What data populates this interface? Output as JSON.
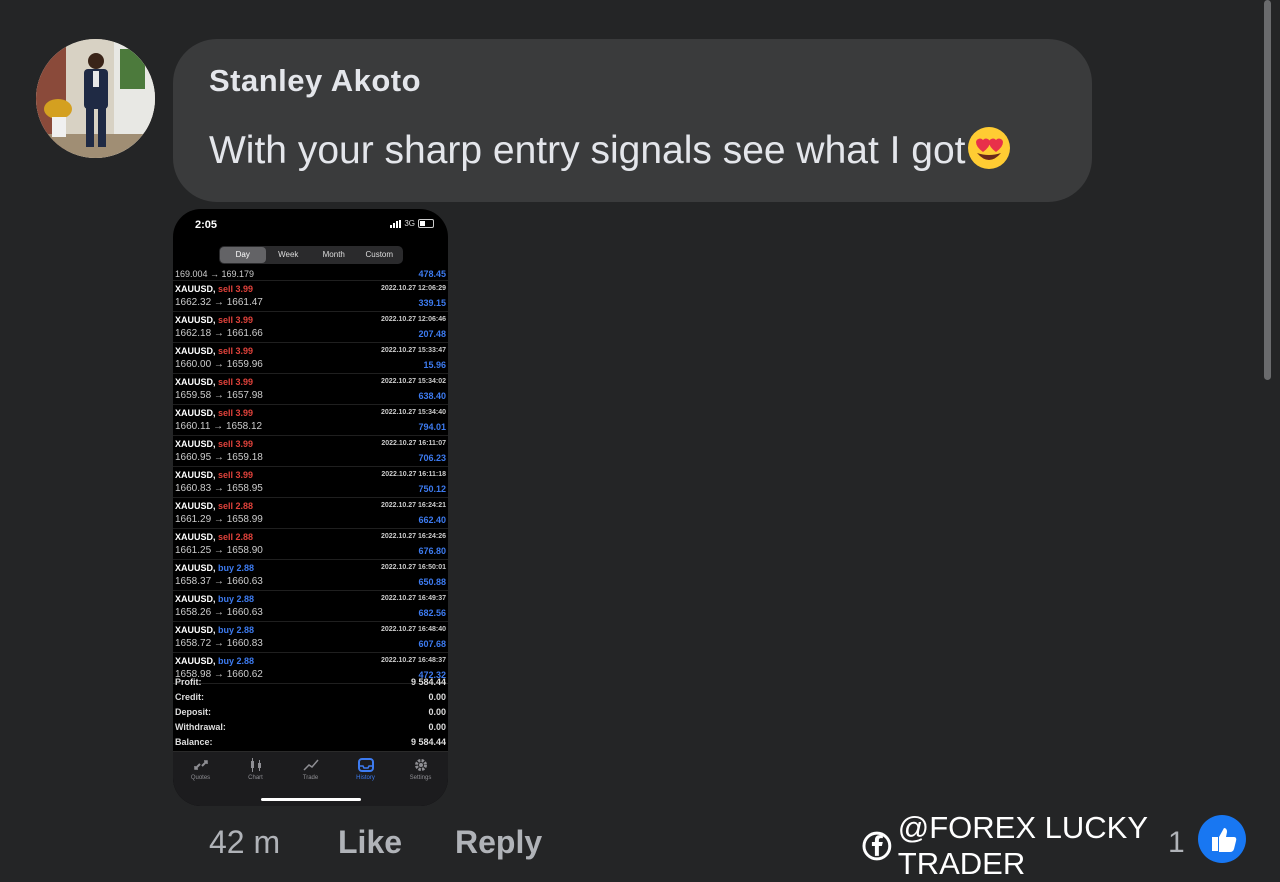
{
  "comment": {
    "author": "Stanley Akoto",
    "text": "With your sharp entry signals see what I got",
    "emoji": "heart-eyes-emoji",
    "timestamp": "42 m",
    "like_label": "Like",
    "reply_label": "Reply",
    "reaction_count": "1"
  },
  "watermark": "@FOREX LUCKY TRADER",
  "phone": {
    "status_time": "2:05",
    "network": "3G",
    "periods": [
      "Day",
      "Week",
      "Month",
      "Custom"
    ],
    "active_period": "Day",
    "partial_row": {
      "prices": "169.004 → 169.179",
      "profit": "478.45"
    },
    "deals": [
      {
        "symbol": "XAUUSD,",
        "side": "sell",
        "volume": "sell 3.99",
        "prices": "1662.32 → 1661.47",
        "time": "2022.10.27 12:06:29",
        "profit": "339.15"
      },
      {
        "symbol": "XAUUSD,",
        "side": "sell",
        "volume": "sell 3.99",
        "prices": "1662.18 → 1661.66",
        "time": "2022.10.27 12:06:46",
        "profit": "207.48"
      },
      {
        "symbol": "XAUUSD,",
        "side": "sell",
        "volume": "sell 3.99",
        "prices": "1660.00 → 1659.96",
        "time": "2022.10.27 15:33:47",
        "profit": "15.96"
      },
      {
        "symbol": "XAUUSD,",
        "side": "sell",
        "volume": "sell 3.99",
        "prices": "1659.58 → 1657.98",
        "time": "2022.10.27 15:34:02",
        "profit": "638.40"
      },
      {
        "symbol": "XAUUSD,",
        "side": "sell",
        "volume": "sell 3.99",
        "prices": "1660.11 → 1658.12",
        "time": "2022.10.27 15:34:40",
        "profit": "794.01"
      },
      {
        "symbol": "XAUUSD,",
        "side": "sell",
        "volume": "sell 3.99",
        "prices": "1660.95 → 1659.18",
        "time": "2022.10.27 16:11:07",
        "profit": "706.23"
      },
      {
        "symbol": "XAUUSD,",
        "side": "sell",
        "volume": "sell 3.99",
        "prices": "1660.83 → 1658.95",
        "time": "2022.10.27 16:11:18",
        "profit": "750.12"
      },
      {
        "symbol": "XAUUSD,",
        "side": "sell",
        "volume": "sell 2.88",
        "prices": "1661.29 → 1658.99",
        "time": "2022.10.27 16:24:21",
        "profit": "662.40"
      },
      {
        "symbol": "XAUUSD,",
        "side": "sell",
        "volume": "sell 2.88",
        "prices": "1661.25 → 1658.90",
        "time": "2022.10.27 16:24:26",
        "profit": "676.80"
      },
      {
        "symbol": "XAUUSD,",
        "side": "buy",
        "volume": "buy 2.88",
        "prices": "1658.37 → 1660.63",
        "time": "2022.10.27 16:50:01",
        "profit": "650.88"
      },
      {
        "symbol": "XAUUSD,",
        "side": "buy",
        "volume": "buy 2.88",
        "prices": "1658.26 → 1660.63",
        "time": "2022.10.27 16:49:37",
        "profit": "682.56"
      },
      {
        "symbol": "XAUUSD,",
        "side": "buy",
        "volume": "buy 2.88",
        "prices": "1658.72 → 1660.83",
        "time": "2022.10.27 16:48:40",
        "profit": "607.68"
      },
      {
        "symbol": "XAUUSD,",
        "side": "buy",
        "volume": "buy 2.88",
        "prices": "1658.98 → 1660.62",
        "time": "2022.10.27 16:48:37",
        "profit": "472.32"
      }
    ],
    "summary": [
      {
        "label": "Profit:",
        "value": "9 584.44"
      },
      {
        "label": "Credit:",
        "value": "0.00"
      },
      {
        "label": "Deposit:",
        "value": "0.00"
      },
      {
        "label": "Withdrawal:",
        "value": "0.00"
      },
      {
        "label": "Balance:",
        "value": "9 584.44"
      }
    ],
    "tabs": [
      {
        "label": "Quotes",
        "icon": "quotes-icon"
      },
      {
        "label": "Chart",
        "icon": "chart-icon"
      },
      {
        "label": "Trade",
        "icon": "trade-icon"
      },
      {
        "label": "History",
        "icon": "history-icon"
      },
      {
        "label": "Settings",
        "icon": "settings-icon"
      }
    ],
    "active_tab": "History"
  },
  "colors": {
    "background": "#242526",
    "bubble": "#3a3b3c",
    "sell": "#e0423b",
    "buy": "#3d7bf0",
    "facebook_blue": "#1877f2"
  }
}
